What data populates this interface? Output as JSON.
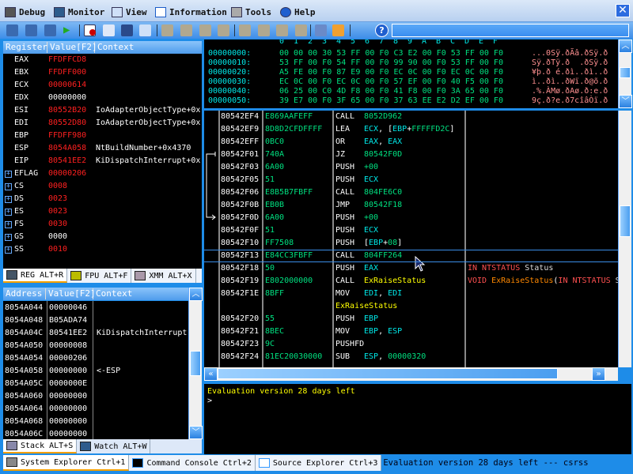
{
  "menu": [
    "Debug",
    "Monitor",
    "View",
    "Information",
    "Tools",
    "Help"
  ],
  "registers": {
    "headers": [
      "Register",
      "Value[F2]",
      "Context"
    ],
    "rows": [
      {
        "name": "EAX",
        "value": "FFDFFCD8",
        "changed": true,
        "context": ""
      },
      {
        "name": "EBX",
        "value": "FFDFF000",
        "changed": true,
        "context": ""
      },
      {
        "name": "ECX",
        "value": "00000614",
        "changed": true,
        "context": ""
      },
      {
        "name": "EDX",
        "value": "00000000",
        "changed": false,
        "context": ""
      },
      {
        "name": "ESI",
        "value": "80552B20",
        "changed": true,
        "context": "IoAdapterObjectType+0x"
      },
      {
        "name": "EDI",
        "value": "80552D80",
        "changed": true,
        "context": "IoAdapterObjectType+0x"
      },
      {
        "name": "EBP",
        "value": "FFDFF980",
        "changed": true,
        "context": ""
      },
      {
        "name": "ESP",
        "value": "8054A058",
        "changed": true,
        "context": "NtBuildNumber+0x4370"
      },
      {
        "name": "EIP",
        "value": "80541EE2",
        "changed": true,
        "context": "KiDispatchInterrupt+0x"
      },
      {
        "name": "EFLAG",
        "value": "00000206",
        "changed": true,
        "context": "",
        "expand": true
      },
      {
        "name": "CS",
        "value": "0008",
        "changed": true,
        "context": "",
        "expand": true
      },
      {
        "name": "DS",
        "value": "0023",
        "changed": true,
        "context": "",
        "expand": true
      },
      {
        "name": "ES",
        "value": "0023",
        "changed": true,
        "context": "",
        "expand": true
      },
      {
        "name": "FS",
        "value": "0030",
        "changed": true,
        "context": "",
        "expand": true
      },
      {
        "name": "GS",
        "value": "0000",
        "changed": false,
        "context": "",
        "expand": true
      },
      {
        "name": "SS",
        "value": "0010",
        "changed": true,
        "context": "",
        "expand": true
      }
    ],
    "tabs": [
      "REG ALT+R",
      "FPU ALT+F",
      "XMM ALT+X"
    ]
  },
  "stack": {
    "headers": [
      "Address",
      "Value[F2]",
      "Context"
    ],
    "rows": [
      {
        "addr": "8054A044",
        "value": "00000046",
        "context": ""
      },
      {
        "addr": "8054A048",
        "value": "B05ADA74",
        "context": ""
      },
      {
        "addr": "8054A04C",
        "value": "80541EE2",
        "context": "KiDispatchInterrupt"
      },
      {
        "addr": "8054A050",
        "value": "00000008",
        "context": ""
      },
      {
        "addr": "8054A054",
        "value": "00000206",
        "context": ""
      },
      {
        "addr": "8054A058",
        "value": "00000000",
        "context": "<-ESP"
      },
      {
        "addr": "8054A05C",
        "value": "0000000E",
        "context": ""
      },
      {
        "addr": "8054A060",
        "value": "00000000",
        "context": ""
      },
      {
        "addr": "8054A064",
        "value": "00000000",
        "context": ""
      },
      {
        "addr": "8054A068",
        "value": "00000000",
        "context": ""
      },
      {
        "addr": "8054A06C",
        "value": "00000000",
        "context": ""
      }
    ],
    "tabs": [
      "Stack ALT+S",
      "Watch ALT+W"
    ]
  },
  "hex": {
    "columns": [
      "0",
      "1",
      "2",
      "3",
      "4",
      "5",
      "6",
      "7",
      "8",
      "9",
      "A",
      "B",
      "C",
      "D",
      "E",
      "F"
    ],
    "rows": [
      {
        "addr": "00000000:",
        "bytes": "00 00 00 30 53 FF 00 F0 C3 E2 00 F0 53 FF 00 F0",
        "ascii": "...0Sÿ.ðÃâ.ðSÿ.ð"
      },
      {
        "addr": "00000010:",
        "bytes": "53 FF 00 F0 54 FF 00 F0 99 90 00 F0 53 FF 00 F0",
        "ascii": "Sÿ.ðTÿ.ð  .ðSÿ.ð"
      },
      {
        "addr": "00000020:",
        "bytes": "A5 FE 00 F0 87 E9 00 F0 EC 0C 00 F0 EC 0C 00 F0",
        "ascii": "¥þ.ð é.ðì..ðì..ð"
      },
      {
        "addr": "00000030:",
        "bytes": "EC 0C 00 F0 EC 0C 00 F0 57 EF 00 F0 40 F5 00 F0",
        "ascii": "ì..ðì..ðWï.ð@õ.ð"
      },
      {
        "addr": "00000040:",
        "bytes": "06 25 00 C0 4D F8 00 F0 41 F8 00 F0 3A 65 00 F0",
        "ascii": ".%.ÀMø.ðAø.ð:e.ð"
      },
      {
        "addr": "00000050:",
        "bytes": "39 E7 00 F0 3F 65 00 F0 37 63 EE E2 D2 EF 00 F0",
        "ascii": "9ç.ð?e.ð7cîâÒï.ð"
      }
    ]
  },
  "disasm": {
    "rows": [
      {
        "addr": "80542EF4",
        "bytes": "E869AAFEFF",
        "mn": "CALL",
        "ops": [
          [
            "8052D962",
            "grn"
          ]
        ]
      },
      {
        "addr": "80542EF9",
        "bytes": "8D8D2CFDFFFF",
        "mn": "LEA",
        "ops": [
          [
            "ECX",
            "cyn"
          ],
          [
            ", [",
            "wht"
          ],
          [
            "EBP",
            "cyn"
          ],
          [
            "+",
            "wht"
          ],
          [
            "FFFFFD2C",
            "grn"
          ],
          [
            "]",
            "wht"
          ]
        ]
      },
      {
        "addr": "80542EFF",
        "bytes": "0BC0",
        "mn": "OR",
        "ops": [
          [
            "EAX",
            "cyn"
          ],
          [
            ", ",
            "wht"
          ],
          [
            "EAX",
            "cyn"
          ]
        ]
      },
      {
        "addr": "80542F01",
        "bytes": "740A",
        "mn": "JZ",
        "ops": [
          [
            "80542F0D",
            "grn"
          ]
        ]
      },
      {
        "addr": "80542F03",
        "bytes": "6A00",
        "mn": "PUSH",
        "ops": [
          [
            "+00",
            "grn"
          ]
        ]
      },
      {
        "addr": "80542F05",
        "bytes": "51",
        "mn": "PUSH",
        "ops": [
          [
            "ECX",
            "cyn"
          ]
        ]
      },
      {
        "addr": "80542F06",
        "bytes": "E8B5B7FBFF",
        "mn": "CALL",
        "ops": [
          [
            "804FE6C0",
            "grn"
          ]
        ]
      },
      {
        "addr": "80542F0B",
        "bytes": "EB0B",
        "mn": "JMP",
        "ops": [
          [
            "80542F18",
            "grn"
          ]
        ]
      },
      {
        "addr": "80542F0D",
        "bytes": "6A00",
        "mn": "PUSH",
        "ops": [
          [
            "+00",
            "grn"
          ]
        ]
      },
      {
        "addr": "80542F0F",
        "bytes": "51",
        "mn": "PUSH",
        "ops": [
          [
            "ECX",
            "cyn"
          ]
        ]
      },
      {
        "addr": "80542F10",
        "bytes": "FF7508",
        "mn": "PUSH",
        "ops": [
          [
            "[",
            "wht"
          ],
          [
            "EBP",
            "cyn"
          ],
          [
            "+",
            "wht"
          ],
          [
            "08",
            "grn"
          ],
          [
            "]",
            "wht"
          ]
        ]
      },
      {
        "addr": "80542F13",
        "bytes": "E84CC3FBFF",
        "mn": "CALL",
        "ops": [
          [
            "804FF264",
            "grn"
          ]
        ],
        "selected": true
      },
      {
        "addr": "80542F18",
        "bytes": "50",
        "mn": "PUSH",
        "ops": [
          [
            "EAX",
            "cyn"
          ]
        ],
        "comment": [
          [
            "IN NTSTATUS ",
            "lred"
          ],
          [
            "Status",
            "gry"
          ]
        ]
      },
      {
        "addr": "80542F19",
        "bytes": "E802000000",
        "mn": "CALL",
        "ops": [
          [
            "ExRaiseStatus",
            "yel"
          ]
        ],
        "comment": [
          [
            "VOID ",
            "lred"
          ],
          [
            "ExRaiseStatus",
            "orng"
          ],
          [
            "(",
            "wht"
          ],
          [
            "IN NTSTATUS ",
            "lred"
          ],
          [
            "S",
            "gry"
          ]
        ]
      },
      {
        "addr": "80542F1E",
        "bytes": "8BFF",
        "mn": "MOV",
        "ops": [
          [
            "EDI",
            "cyn"
          ],
          [
            ", ",
            "wht"
          ],
          [
            "EDI",
            "cyn"
          ]
        ]
      },
      {
        "label": "ExRaiseStatus"
      },
      {
        "addr": "80542F20",
        "bytes": "55",
        "mn": "PUSH",
        "ops": [
          [
            "EBP",
            "cyn"
          ]
        ]
      },
      {
        "addr": "80542F21",
        "bytes": "8BEC",
        "mn": "MOV",
        "ops": [
          [
            "EBP",
            "cyn"
          ],
          [
            ", ",
            "wht"
          ],
          [
            "ESP",
            "cyn"
          ]
        ]
      },
      {
        "addr": "80542F23",
        "bytes": "9C",
        "mn": "PUSHFD",
        "ops": []
      },
      {
        "addr": "80542F24",
        "bytes": "81EC20030000",
        "mn": "SUB",
        "ops": [
          [
            "ESP",
            "cyn"
          ],
          [
            ", ",
            "wht"
          ],
          [
            "00000320",
            "grn"
          ]
        ]
      }
    ]
  },
  "console": {
    "lines": [
      "Evaluation version 28 days left"
    ],
    "prompt": ">"
  },
  "bottom_tabs": [
    "System Explorer Ctrl+1",
    "Command Console Ctrl+2",
    "Source Explorer Ctrl+3"
  ],
  "status": "Evaluation version 28 days left --- csrss",
  "search": {
    "value": ""
  }
}
